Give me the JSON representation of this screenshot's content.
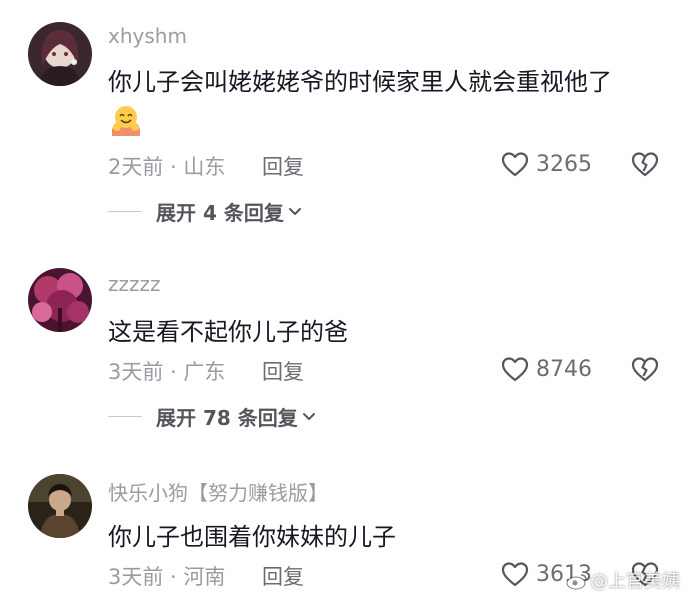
{
  "comments": [
    {
      "username": "xhyshm",
      "text": "你儿子会叫姥姥姥爷的时候家里人就会重视他了",
      "emoji": "hugging-face-emoji",
      "time_location": "2天前 · 山东",
      "reply_label": "回复",
      "likes": "3265",
      "expand_label": "展开 4 条回复"
    },
    {
      "username": "zzzzz",
      "text": "这是看不起你儿子的爸",
      "time_location": "3天前 · 广东",
      "reply_label": "回复",
      "likes": "8746",
      "expand_label": "展开 78 条回复"
    },
    {
      "username": "快乐小狗【努力赚钱版】",
      "text": "你儿子也围着你妹妹的儿子",
      "time_location": "3天前 · 河南",
      "reply_label": "回复",
      "likes": "3613"
    }
  ],
  "watermark": "@上官美姨",
  "colors": {
    "text": "#161823",
    "secondary": "#9a9ca3",
    "action": "#6b6d74"
  }
}
